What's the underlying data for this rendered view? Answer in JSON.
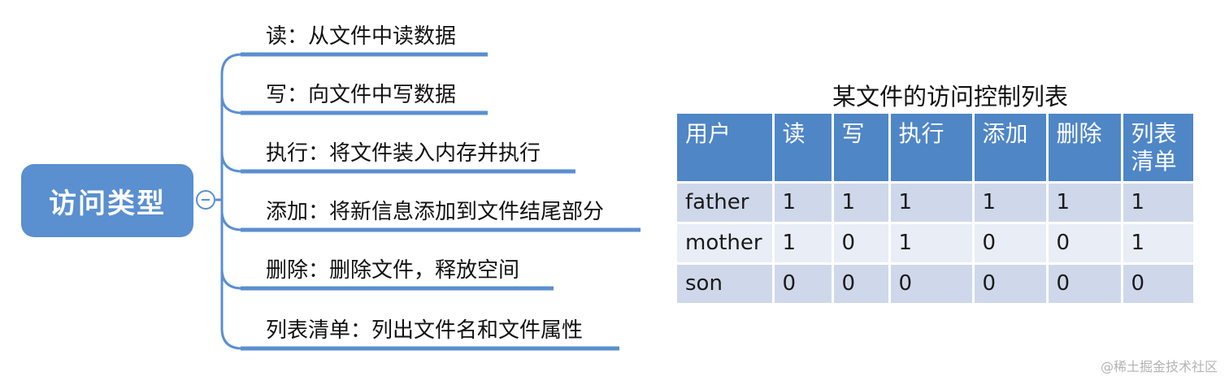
{
  "mindmap": {
    "root_label": "访问类型",
    "branches": [
      {
        "label": "读：从文件中读数据"
      },
      {
        "label": "写：向文件中写数据"
      },
      {
        "label": "执行：将文件装入内存并执行"
      },
      {
        "label": "添加：将新信息添加到文件结尾部分"
      },
      {
        "label": "删除：删除文件，释放空间"
      },
      {
        "label": "列表清单：列出文件名和文件属性"
      }
    ]
  },
  "acl": {
    "title": "某文件的访问控制列表",
    "headers": [
      "用户",
      "读",
      "写",
      "执行",
      "添加",
      "删除",
      "列表\n清单"
    ],
    "rows": [
      [
        "father",
        "1",
        "1",
        "1",
        "1",
        "1",
        "1"
      ],
      [
        "mother",
        "1",
        "0",
        "1",
        "0",
        "0",
        "1"
      ],
      [
        "son",
        "0",
        "0",
        "0",
        "0",
        "0",
        "0"
      ]
    ]
  },
  "watermark": "@稀土掘金技术社区",
  "colors": {
    "accent": "#5a8fd0",
    "header": "#4f86c6",
    "row_dark": "#cfd8ea",
    "row_light": "#e8edf6"
  }
}
